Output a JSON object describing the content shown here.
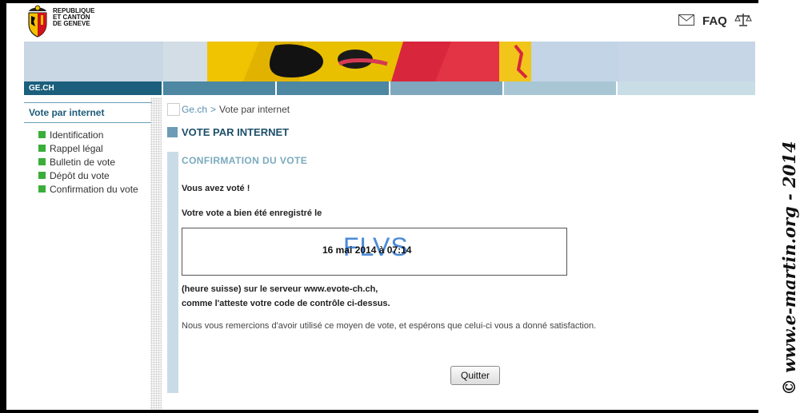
{
  "header": {
    "logo_line1": "REPUBLIQUE",
    "logo_line2": "ET CANTON",
    "logo_line3": "DE GENEVE",
    "faq_label": "FAQ",
    "mail_icon": "mail-icon",
    "balance_icon": "balance-scale-icon"
  },
  "nav": {
    "gech_label": "GE.CH",
    "strip_colors": [
      "#1b5f7c",
      "#4d87a2",
      "#4d87a2",
      "#7fa8bf",
      "#a8c6d4",
      "#c8dde6"
    ]
  },
  "sidebar": {
    "title": "Vote par internet",
    "items": [
      {
        "label": "Identification"
      },
      {
        "label": "Rappel légal"
      },
      {
        "label": "Bulletin de vote"
      },
      {
        "label": "Dépôt du vote"
      },
      {
        "label": "Confirmation du vote"
      }
    ]
  },
  "breadcrumb": {
    "home": "Ge.ch",
    "separator": ">",
    "current": "Vote par internet"
  },
  "main": {
    "page_title": "VOTE PAR INTERNET",
    "section_title": "CONFIRMATION DU VOTE",
    "msg_voted": "Vous avez voté !",
    "msg_recorded": "Votre vote a bien été enregistré le",
    "control_code": "FLVS",
    "vote_timestamp": "16 mai 2014 à 07:14",
    "msg_server": "(heure suisse) sur le serveur www.evote-ch.ch,",
    "msg_attest": "comme l'atteste votre code de contrôle ci-dessus.",
    "msg_thanks": "Nous vous remercions d'avoir utilisé ce moyen de vote, et espérons que celui-ci vous a donné satisfaction.",
    "quit_label": "Quitter"
  },
  "watermark": {
    "text": "© www.e-martin.org - 2014"
  }
}
